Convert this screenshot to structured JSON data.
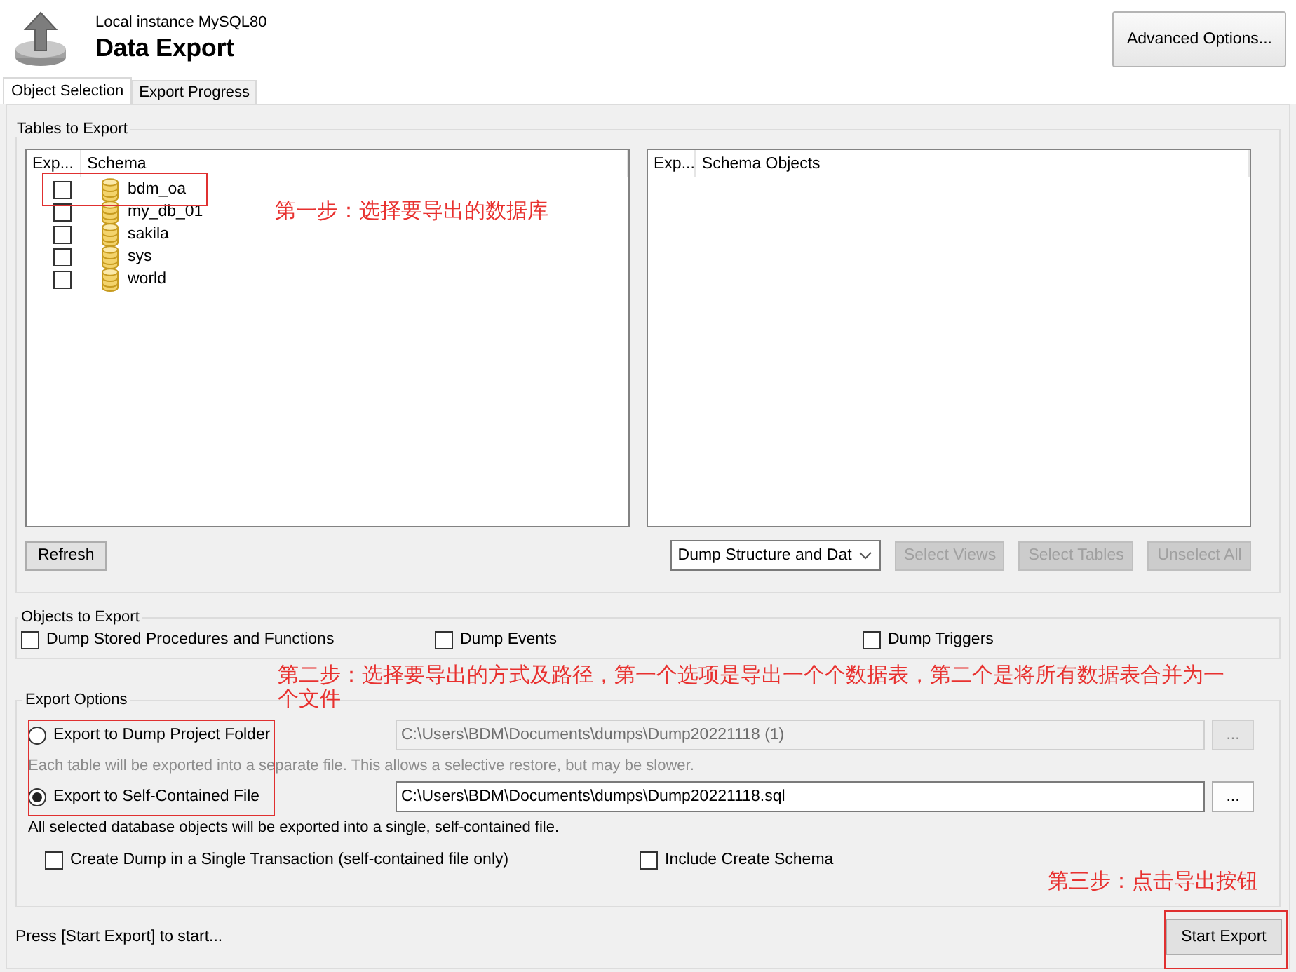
{
  "header": {
    "subtitle": "Local instance MySQL80",
    "title": "Data Export",
    "advanced_button": "Advanced Options..."
  },
  "tabs": [
    {
      "label": "Object Selection",
      "selected": true
    },
    {
      "label": "Export Progress",
      "selected": false
    }
  ],
  "tables_to_export": {
    "title": "Tables to Export",
    "schema_list": {
      "columns": [
        "Exp...",
        "Schema"
      ],
      "rows": [
        {
          "name": "bdm_oa",
          "checked": false
        },
        {
          "name": "my_db_01",
          "checked": false
        },
        {
          "name": "sakila",
          "checked": false
        },
        {
          "name": "sys",
          "checked": false
        },
        {
          "name": "world",
          "checked": false
        }
      ]
    },
    "objects_list": {
      "columns": [
        "Exp...",
        "Schema Objects"
      ]
    },
    "refresh_button": "Refresh",
    "dump_select": {
      "value": "Dump Structure and Dat"
    },
    "buttons": [
      {
        "label": "Select Views",
        "disabled": true
      },
      {
        "label": "Select Tables",
        "disabled": true
      },
      {
        "label": "Unselect All",
        "disabled": true
      }
    ]
  },
  "objects_to_export": {
    "title": "Objects to Export",
    "options": [
      {
        "label": "Dump Stored Procedures and Functions",
        "checked": false
      },
      {
        "label": "Dump Events",
        "checked": false
      },
      {
        "label": "Dump Triggers",
        "checked": false
      }
    ]
  },
  "export_options": {
    "title": "Export Options",
    "modes": [
      {
        "label": "Export to Dump Project Folder",
        "selected": false,
        "path": "C:\\Users\\BDM\\Documents\\dumps\\Dump20221118 (1)",
        "browse": "...",
        "note": "Each table will be exported into a separate file. This allows a selective restore, but may be slower."
      },
      {
        "label": "Export to Self-Contained File",
        "selected": true,
        "path": "C:\\Users\\BDM\\Documents\\dumps\\Dump20221118.sql",
        "browse": "...",
        "note": "All selected database objects will be exported into a single, self-contained file."
      }
    ],
    "options": [
      {
        "label": "Create Dump in a Single Transaction (self-contained file only)",
        "checked": false
      },
      {
        "label": "Include Create Schema",
        "checked": false
      }
    ]
  },
  "status": "Press [Start Export] to start...",
  "start_button": "Start Export",
  "annotations": [
    {
      "text": "第一步：选择要导出的数据库"
    },
    {
      "text": "第二步：选择要导出的方式及路径，第一个选项是导出一个个数据表，第二个是将所有数据表合并为一个文件"
    },
    {
      "text": "第三步：点击导出按钮"
    }
  ]
}
